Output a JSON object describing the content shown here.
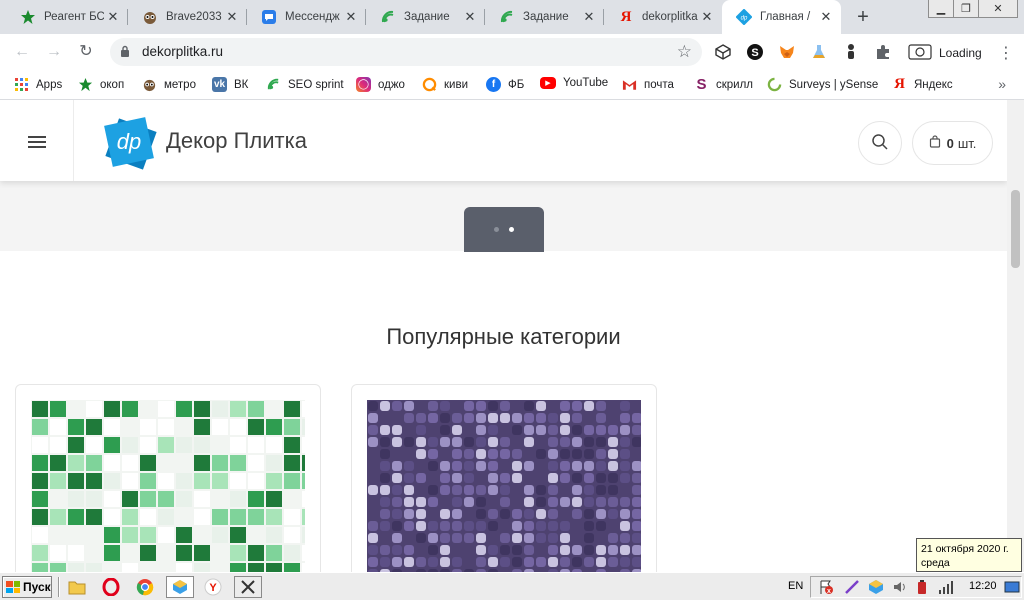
{
  "tabs": [
    {
      "title": "Реагент БС",
      "icon": "green-star-icon"
    },
    {
      "title": "Brave2033",
      "icon": "owl-icon"
    },
    {
      "title": "Мессендж",
      "icon": "messenger-icon"
    },
    {
      "title": "Задание",
      "icon": "seosprint-icon"
    },
    {
      "title": "Задание",
      "icon": "seosprint-icon"
    },
    {
      "title": "dekorplitka",
      "icon": "yandex-icon"
    },
    {
      "title": "Главная /",
      "icon": "dp-icon",
      "active": true
    }
  ],
  "toolbar": {
    "url": "dekorplitka.ru",
    "status_label": "Loading"
  },
  "bookmarks": [
    {
      "label": "Apps",
      "icon": "apps-grid-icon"
    },
    {
      "label": "окоп",
      "icon": "green-star-icon"
    },
    {
      "label": "метро",
      "icon": "owl-icon"
    },
    {
      "label": "ВК",
      "icon": "vk-icon"
    },
    {
      "label": "SEO sprint",
      "icon": "seosprint-icon"
    },
    {
      "label": "оджо",
      "icon": "instagram-icon"
    },
    {
      "label": "киви",
      "icon": "qiwi-icon"
    },
    {
      "label": "ФБ",
      "icon": "facebook-icon"
    },
    {
      "label": "YouTube",
      "icon": "youtube-icon"
    },
    {
      "label": "почта",
      "icon": "gmail-icon"
    },
    {
      "label": "скрилл",
      "icon": "skrill-icon"
    },
    {
      "label": "Surveys | ySense",
      "icon": "ysense-icon"
    },
    {
      "label": "Яндекс",
      "icon": "yandex-icon"
    }
  ],
  "site": {
    "logo_mark": "dp",
    "logo_text": "Декор Плитка",
    "cart_count": "0",
    "cart_unit": "шт.",
    "section_title": "Популярные категории",
    "slider_active_index": 1,
    "slider_dots": 2
  },
  "tooltip": {
    "date": "21 октября 2020 г.",
    "weekday": "среда"
  },
  "taskbar": {
    "start_label": "Пуск",
    "language": "EN",
    "time": "12:20"
  },
  "colors": {
    "logo_blue": "#1da1e2",
    "chrome_tabstrip": "#dee1e6",
    "slider_dots_bg": "#5a5f6b"
  }
}
